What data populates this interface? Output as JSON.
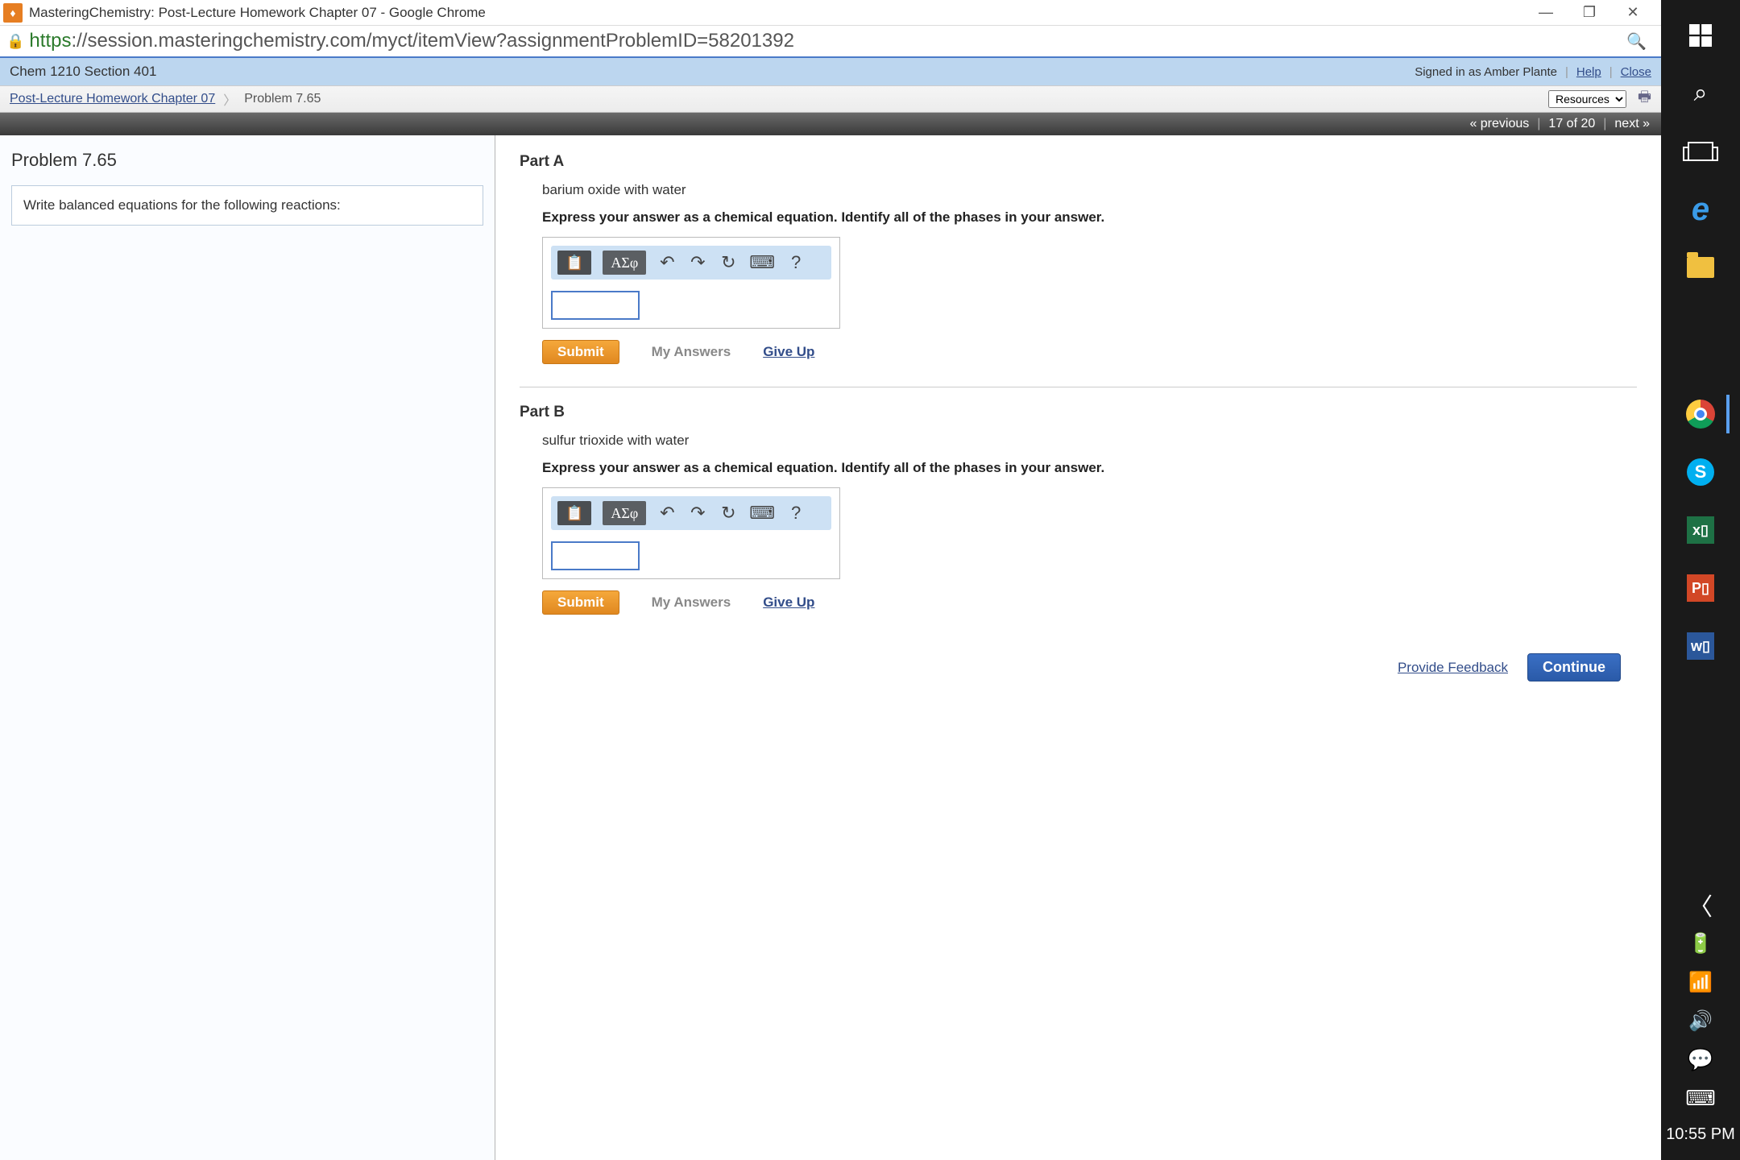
{
  "window": {
    "title": "MasteringChemistry: Post-Lecture Homework Chapter 07 - Google Chrome"
  },
  "address": {
    "scheme": "https",
    "url_rest": "://session.masteringchemistry.com/myct/itemView?assignmentProblemID=58201392"
  },
  "course_bar": {
    "course": "Chem 1210 Section 401",
    "signed_in": "Signed in as Amber Plante",
    "help": "Help",
    "close": "Close"
  },
  "breadcrumb": {
    "parent": "Post-Lecture Homework Chapter 07",
    "current": "Problem 7.65",
    "resources": "Resources"
  },
  "nav": {
    "previous": "« previous",
    "position": "17 of 20",
    "next": "next »"
  },
  "sidebar": {
    "title": "Problem 7.65",
    "instruction": "Write balanced equations for the following reactions:"
  },
  "toolbar": {
    "greek": "ΑΣφ"
  },
  "parts": [
    {
      "label": "Part A",
      "subject": "barium oxide with water",
      "instruction": "Express your answer as a chemical equation. Identify all of the phases in your answer.",
      "submit": "Submit",
      "my_answers": "My Answers",
      "give_up": "Give Up"
    },
    {
      "label": "Part B",
      "subject": "sulfur trioxide with water",
      "instruction": "Express your answer as a chemical equation. Identify all of the phases in your answer.",
      "submit": "Submit",
      "my_answers": "My Answers",
      "give_up": "Give Up"
    }
  ],
  "footer": {
    "feedback": "Provide Feedback",
    "continue": "Continue"
  },
  "taskbar": {
    "clock": "10:55 PM"
  }
}
